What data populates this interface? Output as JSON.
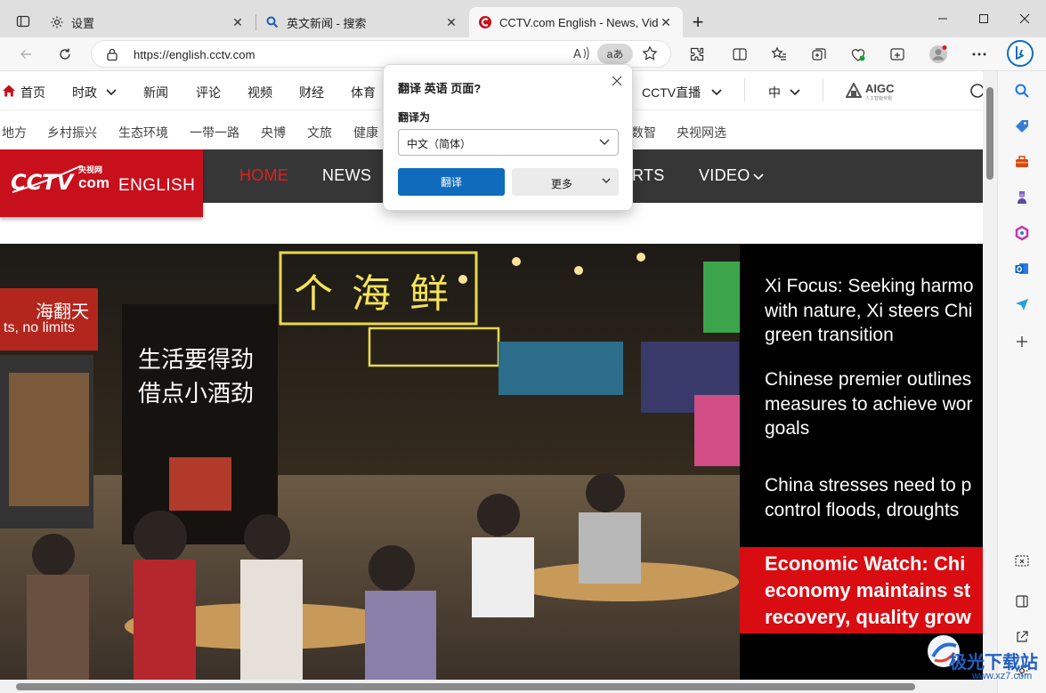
{
  "browser": {
    "tabs": [
      {
        "title": "设置",
        "icon": "gear-icon",
        "active": false
      },
      {
        "title": "英文新闻 - 搜索",
        "icon": "search-icon",
        "active": false
      },
      {
        "title": "CCTV.com English - News, Videos",
        "icon": "cctv-favicon-icon",
        "active": true
      }
    ],
    "url": "https://english.cctv.com",
    "translate_pill": "aあ"
  },
  "cctv": {
    "channels_row1": [
      "首页",
      "时政",
      "新闻",
      "评论",
      "视频",
      "财经",
      "体育",
      "CCTV直播",
      "中"
    ],
    "aigc_label": "AIGC",
    "aigc_sub": "人工智能专题",
    "channels_row2": [
      "地方",
      "乡村振兴",
      "生态环境",
      "一带一路",
      "央博",
      "文旅",
      "健康",
      "数智",
      "央视网选"
    ],
    "logo_text": "ENGLISH",
    "logo_cn": "央视网",
    "logo_com": "com",
    "nav": [
      "HOME",
      "NEWS",
      "RTS",
      "VIDEO"
    ],
    "headlines": [
      "Xi Focus: Seeking harmo",
      "with nature, Xi steers Chi",
      "green transition",
      "Chinese premier outlines",
      "measures to achieve wor",
      "goals",
      "China stresses need to p",
      "control floods, droughts"
    ],
    "featured": [
      "Economic Watch: Chi",
      "economy maintains st",
      "recovery, quality grow"
    ],
    "hero_signs": [
      "个",
      "海",
      "鲜",
      "生活要得劲",
      "借点小酒劲",
      "海翻天",
      "ts, no limits"
    ]
  },
  "translate_popup": {
    "title": "翻译 英语 页面?",
    "label": "翻译为",
    "selected_language": "中文（简体）",
    "translate_button": "翻译",
    "more_button": "更多"
  },
  "watermark": {
    "brand": "极光下载站",
    "url": "www.xz7.com"
  },
  "colors": {
    "cctv_red": "#c8101d",
    "nav_dark": "#363636",
    "edge_blue": "#0f6cbd",
    "headline_red": "#d90c12"
  }
}
